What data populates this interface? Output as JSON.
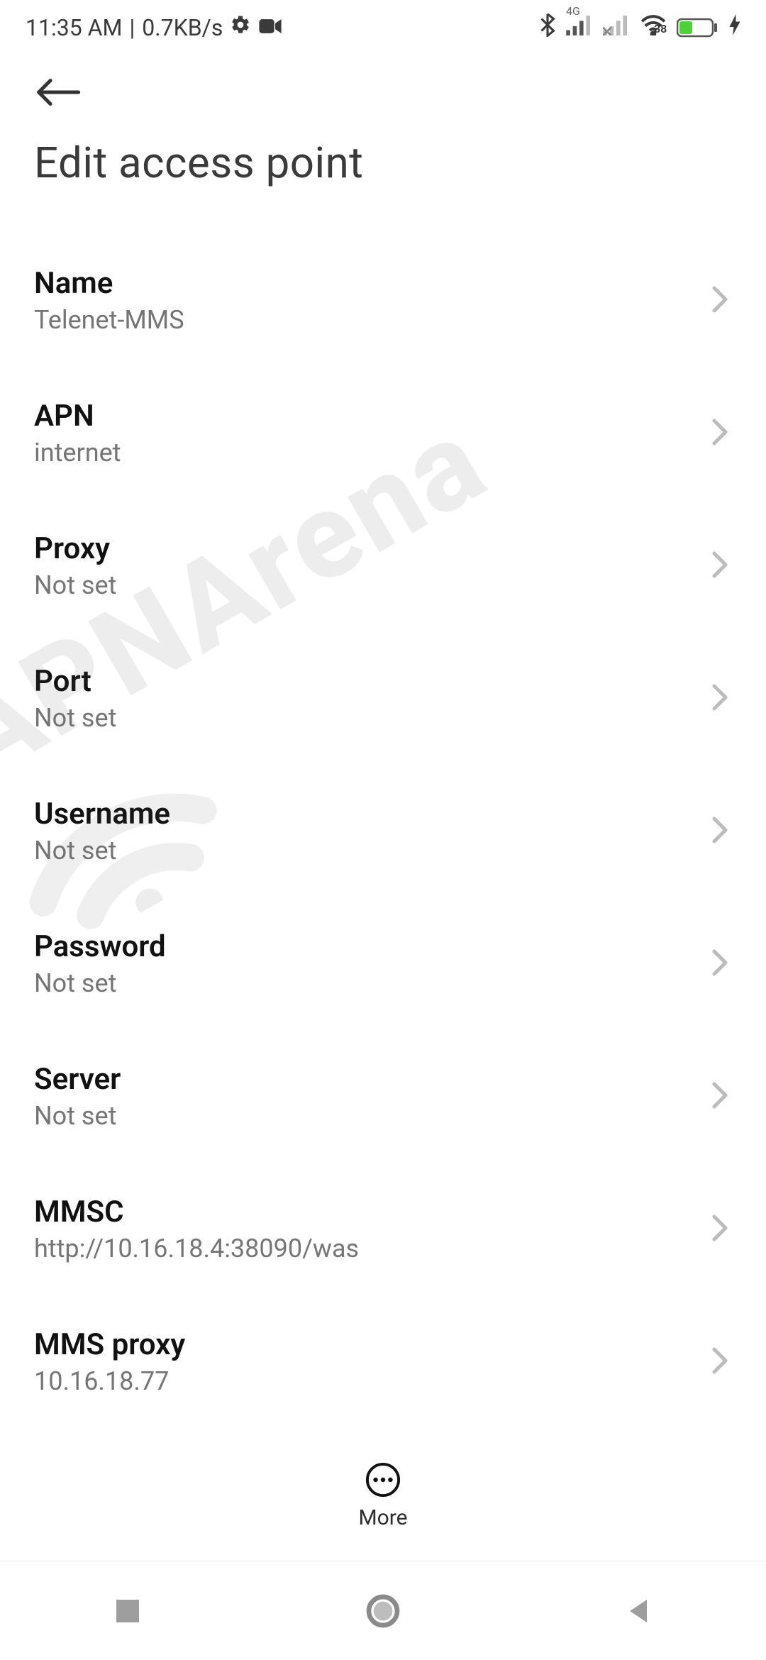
{
  "statusbar": {
    "time": "11:35 AM",
    "net_speed": "0.7KB/s",
    "signal_label": "4G",
    "battery_percent": "38"
  },
  "header": {
    "title": "Edit access point"
  },
  "items": [
    {
      "label": "Name",
      "value": "Telenet-MMS"
    },
    {
      "label": "APN",
      "value": "internet"
    },
    {
      "label": "Proxy",
      "value": "Not set"
    },
    {
      "label": "Port",
      "value": "Not set"
    },
    {
      "label": "Username",
      "value": "Not set"
    },
    {
      "label": "Password",
      "value": "Not set"
    },
    {
      "label": "Server",
      "value": "Not set"
    },
    {
      "label": "MMSC",
      "value": "http://10.16.18.4:38090/was"
    },
    {
      "label": "MMS proxy",
      "value": "10.16.18.77"
    }
  ],
  "more_label": "More",
  "watermark": "APNArena"
}
